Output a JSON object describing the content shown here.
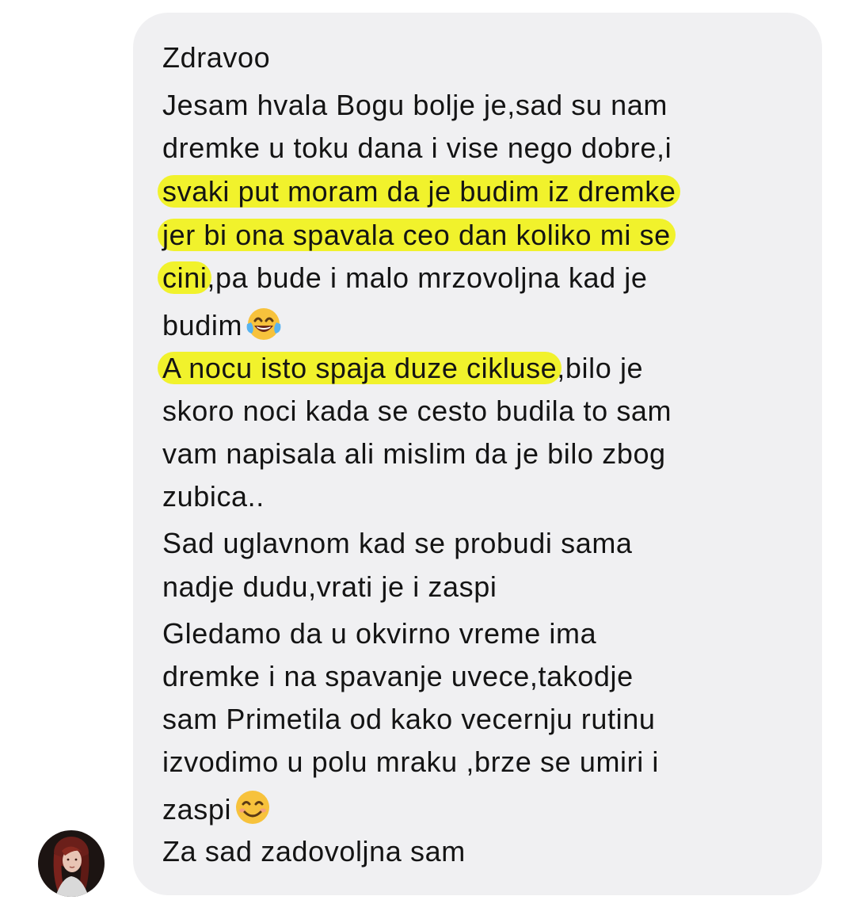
{
  "message": {
    "lines": [
      {
        "before": "Zdravoo",
        "highlight": "",
        "after": ""
      },
      {
        "before": "Jesam hvala  Bogu bolje je,sad su nam",
        "highlight": "",
        "after": ""
      },
      {
        "before": "dremke u toku dana i vise nego dobre,i",
        "highlight": "",
        "after": ""
      },
      {
        "before": "",
        "highlight": "svaki put moram da je budim iz dremke",
        "after": ""
      },
      {
        "before": "",
        "highlight": "jer bi ona spavala ceo dan koliko mi se",
        "after": ""
      },
      {
        "before": "",
        "highlight": "cini",
        "after": ",pa bude i malo mrzovoljna kad je"
      },
      {
        "before": "budim",
        "highlight": "",
        "after": "",
        "emoji": "laughing-tears-emoji"
      },
      {
        "before": "",
        "highlight": "A nocu isto spaja duze cikluse",
        "after": ",bilo je"
      },
      {
        "before": "skoro noci kada se cesto budila to sam",
        "highlight": "",
        "after": ""
      },
      {
        "before": "vam napisala ali mislim da je bilo zbog",
        "highlight": "",
        "after": ""
      },
      {
        "before": "zubica..",
        "highlight": "",
        "after": ""
      },
      {
        "before": "Sad uglavnom kad se probudi sama",
        "highlight": "",
        "after": ""
      },
      {
        "before": "nadje dudu,vrati je i zaspi",
        "highlight": "",
        "after": ""
      },
      {
        "before": "Gledamo da u okvirno vreme ima",
        "highlight": "",
        "after": ""
      },
      {
        "before": "dremke i na spavanje uvece,takodje",
        "highlight": "",
        "after": ""
      },
      {
        "before": "sam Primetila od kako vecernju rutinu",
        "highlight": "",
        "after": ""
      },
      {
        "before": "izvodimo u polu mraku ,brze se umiri i",
        "highlight": "",
        "after": ""
      },
      {
        "before": "zaspi",
        "highlight": "",
        "after": "",
        "emoji": "smiling-face-emoji"
      },
      {
        "before": "Za sad zadovoljna sam",
        "highlight": "",
        "after": ""
      }
    ]
  },
  "colors": {
    "bubble_background": "#f0f0f2",
    "highlight": "#f1f22c",
    "text": "#141414"
  },
  "avatar": {
    "icon": "user-avatar"
  }
}
